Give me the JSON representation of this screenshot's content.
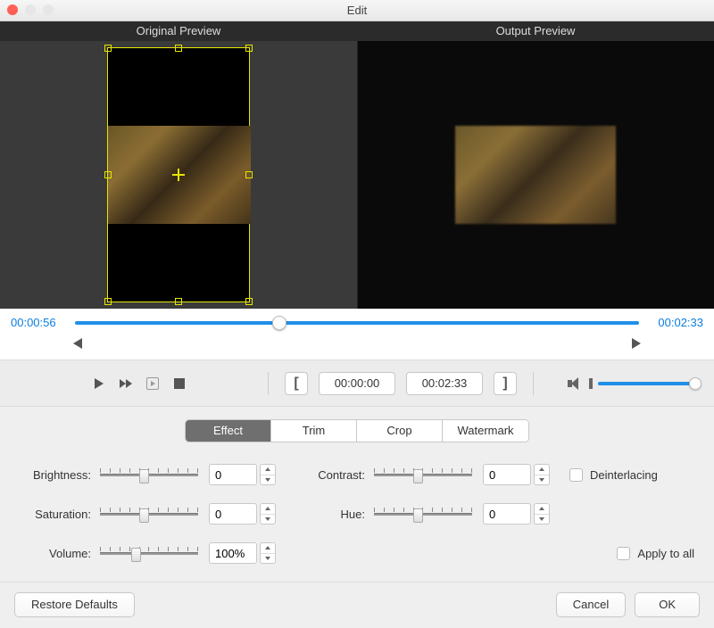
{
  "window": {
    "title": "Edit"
  },
  "preview": {
    "original_label": "Original Preview",
    "output_label": "Output Preview"
  },
  "timeline": {
    "current": "00:00:56",
    "total": "00:02:33",
    "in": "00:00:00",
    "out": "00:02:33"
  },
  "tabs": {
    "effect": "Effect",
    "trim": "Trim",
    "crop": "Crop",
    "watermark": "Watermark"
  },
  "labels": {
    "brightness": "Brightness:",
    "contrast": "Contrast:",
    "saturation": "Saturation:",
    "hue": "Hue:",
    "volume": "Volume:",
    "deinterlacing": "Deinterlacing",
    "apply_all": "Apply to all"
  },
  "values": {
    "brightness": "0",
    "contrast": "0",
    "saturation": "0",
    "hue": "0",
    "volume": "100%"
  },
  "buttons": {
    "restore": "Restore Defaults",
    "cancel": "Cancel",
    "ok": "OK"
  }
}
